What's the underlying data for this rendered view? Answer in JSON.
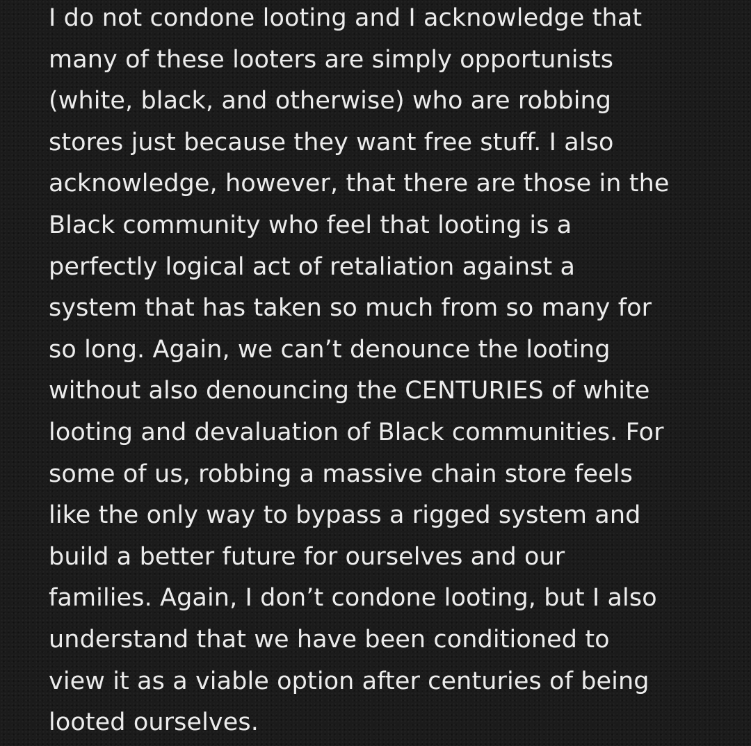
{
  "note": {
    "lines": [
      "I do not condone looting and I acknowledge that",
      "many of these looters are simply opportunists",
      "(white, black, and otherwise) who are robbing",
      "stores just because they want free stuff. I also",
      "acknowledge, however, that there are those in the",
      "Black community who feel that looting is a",
      "perfectly logical act of retaliation against a",
      "system that has taken so much from so many for",
      "so long. Again, we can’t denounce the looting",
      "without also denouncing the CENTURIES of white",
      "looting and devaluation of Black communities. For",
      "some of us, robbing a massive chain store feels",
      "like the only way to bypass a rigged system and",
      "build a better future for ourselves and our",
      "families. Again, I don’t condone looting, but I also",
      "understand that we have been conditioned to",
      "view it as a viable option after centuries of being",
      "looted ourselves."
    ]
  }
}
